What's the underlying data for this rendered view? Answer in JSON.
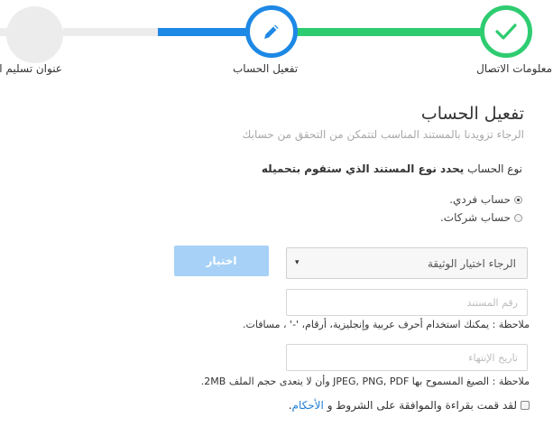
{
  "stepper": {
    "colors": {
      "done": "#2ecc71",
      "active": "#1e88e5",
      "pending": "#ececec"
    },
    "steps": [
      {
        "label": "معلومات الاتصال",
        "state": "done",
        "icon": "check-icon"
      },
      {
        "label": "تفعيل الحساب",
        "state": "active",
        "icon": "pencil-icon"
      },
      {
        "label": "عنوان تسليم الطلب",
        "state": "pending",
        "icon": ""
      }
    ]
  },
  "form": {
    "title": "تفعيل الحساب",
    "subtitle": "الرجاء تزويدنا بالمستند المناسب لتتمكن من التحقق من حسابك",
    "doc_question_prefix": "نوع الحساب",
    "doc_question_bold": "يحدد نوع المستند الذي ستقوم بتحميله",
    "radio_options": [
      {
        "label": "حساب فردي.",
        "selected": true
      },
      {
        "label": "حساب شركات.",
        "selected": false
      }
    ],
    "document_select": {
      "value": "الرجاء اختيار الوثيقة",
      "caret": "▾"
    },
    "choose_button": "اختيار",
    "document_number_placeholder": "رقم المستند",
    "note_1": "ملاحظة : يمكنك استخدام أحرف عربية وإنجليزية، أرقام، '-' ، مسافات.",
    "expiry_placeholder": "تاريخ الإنتهاء",
    "note_2": "ملاحظة : الصيغ المسموح بها JPEG, PNG, PDF وأن لا يتعدى حجم الملف 2MB.",
    "terms_text": "لقد قمت بقراءة والموافقة على الشروط و",
    "terms_link": "الأحكام",
    "terms_end": ".",
    "link_color": "#1f7ed6",
    "button_color": "#a7d1f6"
  }
}
